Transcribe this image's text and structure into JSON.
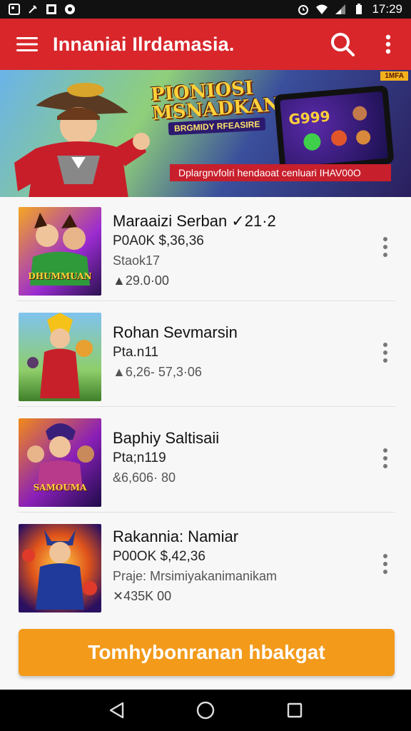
{
  "status_bar": {
    "time": "17:29"
  },
  "app_bar": {
    "title": "Innaniai Ilrdamasia."
  },
  "banner": {
    "promo_title_line1": "PIONIOSI",
    "promo_title_line2": "MSNADKAN",
    "promo_subtitle": "BRGMIDY RFEASIRE",
    "tablet_text": "G999",
    "corner_badge": "1MFA",
    "caption": "Dplargnvfolri hendaoat cenluari IHAV00O"
  },
  "items": [
    {
      "title": "Maraaizi Serban ✓21·2",
      "line2": "P0A0K $,36,36",
      "line3": "Staok17",
      "line4": "▲29.0·00",
      "thumb_label": "DHUMMUAN"
    },
    {
      "title": "Rohan Sevmarsin",
      "line2": "Pta.n11",
      "line3": "▲6,26- 57,3·06",
      "line4": "",
      "thumb_label": ""
    },
    {
      "title": "Baphiy Saltisaii",
      "line2": "Pta;n119",
      "line3": "&6,606· 80",
      "line4": "",
      "thumb_label": "SAMOUMA"
    },
    {
      "title": "Rakannia: Namiar",
      "line2": "P00OK $,42,36",
      "line3": "Praje: Mrsimiyakanimanikam",
      "line4": "✕435K 00",
      "thumb_label": ""
    }
  ],
  "cta": {
    "label": "Tomhybonranan hbakgat"
  },
  "colors": {
    "app_bar": "#d8262b",
    "cta": "#f39a1b"
  }
}
